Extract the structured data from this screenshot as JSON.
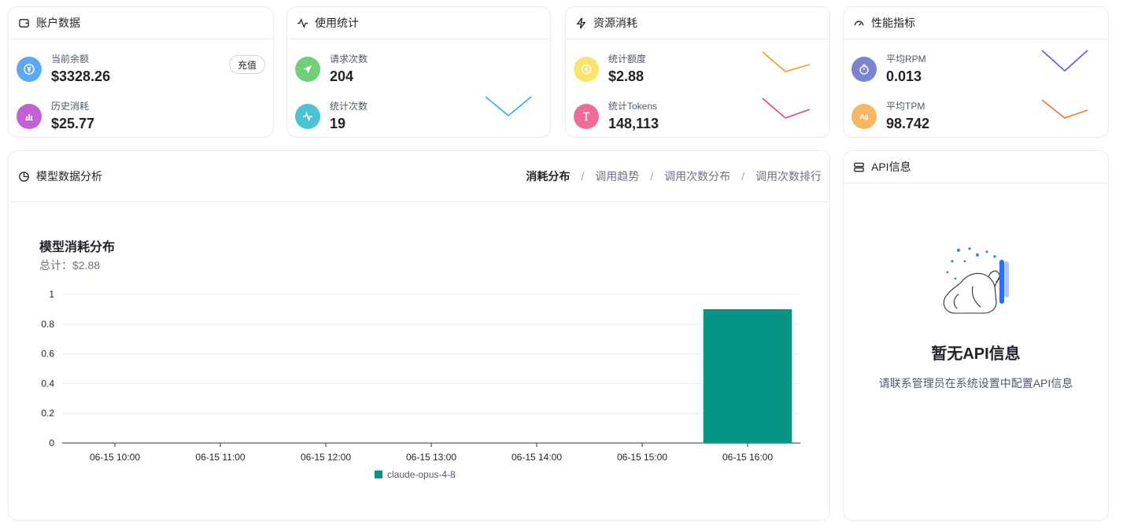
{
  "account": {
    "title": "账户数据",
    "balance_label": "当前余额",
    "balance_value": "$3328.26",
    "recharge_label": "充值",
    "spent_label": "历史消耗",
    "spent_value": "$25.77"
  },
  "usage": {
    "title": "使用统计",
    "requests_label": "请求次数",
    "requests_value": "204",
    "count_label": "统计次数",
    "count_value": "19"
  },
  "resource": {
    "title": "资源消耗",
    "quota_label": "统计额度",
    "quota_value": "$2.88",
    "tokens_label": "统计Tokens",
    "tokens_value": "148,113"
  },
  "performance": {
    "title": "性能指标",
    "rpm_label": "平均RPM",
    "rpm_value": "0.013",
    "tpm_label": "平均TPM",
    "tpm_value": "98.742"
  },
  "analysis": {
    "title": "模型数据分析",
    "tabs": [
      "消耗分布",
      "调用趋势",
      "调用次数分布",
      "调用次数排行"
    ],
    "chart_title": "模型消耗分布",
    "chart_subtitle": "总计：$2.88"
  },
  "api_info": {
    "title": "API信息",
    "empty_title": "暂无API信息",
    "empty_desc": "请联系管理员在系统设置中配置API信息"
  },
  "colors": {
    "bar": "#069484",
    "balance_icon": "#5ba8f5",
    "spent_icon": "#c35fd8",
    "requests_icon": "#6fcf7a",
    "count_icon": "#4bc3d3",
    "quota_icon": "#fbe36c",
    "tokens_icon": "#ee6c95",
    "rpm_icon": "#7d84cf",
    "tpm_icon": "#f7b764"
  },
  "chart_data": {
    "type": "bar",
    "title": "模型消耗分布",
    "subtitle": "总计：$2.88",
    "categories": [
      "06-15 10:00",
      "06-15 11:00",
      "06-15 12:00",
      "06-15 13:00",
      "06-15 14:00",
      "06-15 15:00",
      "06-15 16:00"
    ],
    "series": [
      {
        "name": "claude-opus-4-8",
        "values": [
          0,
          0,
          0,
          0,
          0,
          0,
          0.9
        ]
      }
    ],
    "ylim": [
      0,
      1
    ],
    "yticks": [
      "0",
      "0.2",
      "0.4",
      "0.6",
      "0.8",
      "1"
    ],
    "grid": true,
    "legend": "bottom-center"
  }
}
